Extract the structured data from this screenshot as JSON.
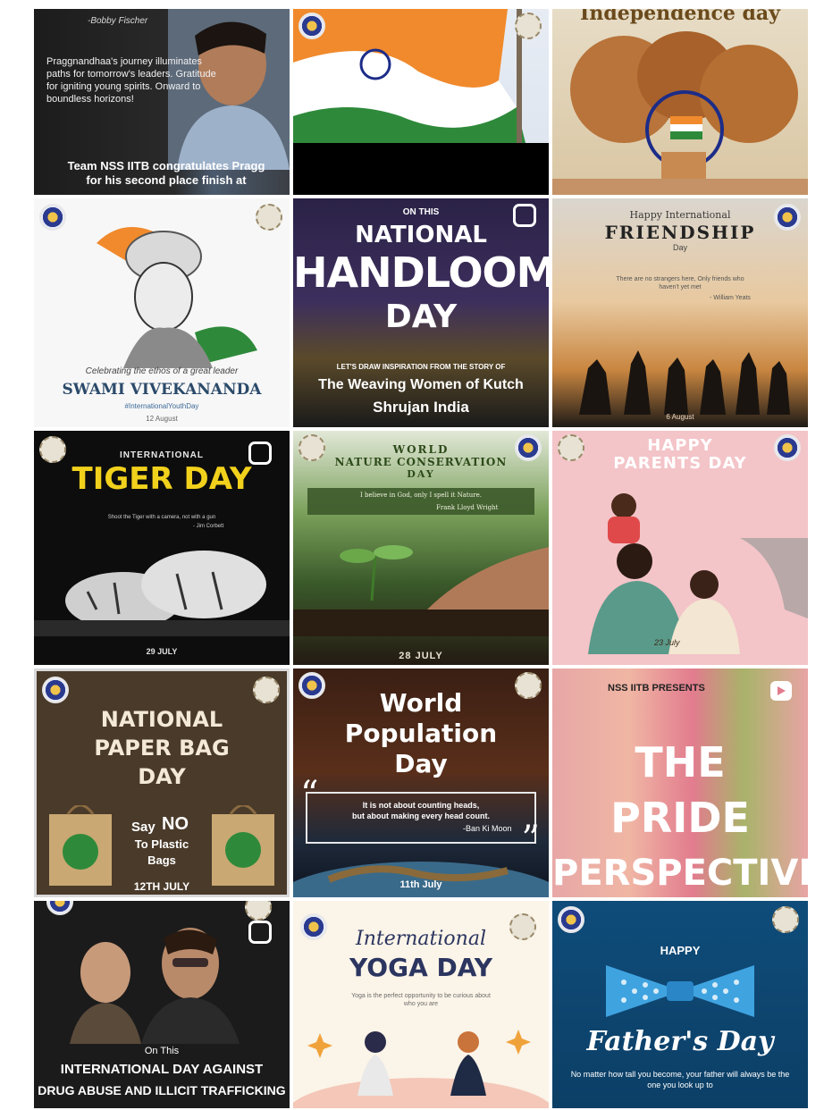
{
  "tiles": {
    "pragg": {
      "attribution": "-Bobby Fischer",
      "quote": "Praggnandhaa's journey illuminates paths for tomorrow's leaders. Gratitude for igniting young spirits. Onward to boundless horizons!",
      "caption": "Team NSS IITB congratulates Pragg for his second place finish at"
    },
    "indep": {
      "heading": "Independence day"
    },
    "vivek": {
      "tagline": "Celebrating the ethos of a great leader",
      "title": "SWAMI VIVEKANANDA",
      "hashtag": "#InternationalYouthDay",
      "date": "12 August"
    },
    "handloom": {
      "kicker": "ON THIS",
      "line1": "NATIONAL",
      "line2": "HANDLOOM",
      "line3": "DAY",
      "sub": "LET'S DRAW INSPIRATION FROM THE STORY OF",
      "story1": "The Weaving Women of Kutch",
      "story2": "Shrujan India"
    },
    "friendship": {
      "pre": "Happy International",
      "title": "FRIENDSHIP",
      "day": "Day",
      "quote": "There are no strangers here, Only friends who haven't yet met",
      "author": "- William Yeats",
      "date": "6 August"
    },
    "tiger": {
      "pre": "INTERNATIONAL",
      "title": "TIGER DAY",
      "quote": "Shoot the Tiger with a camera, not with a gun",
      "author": "- Jim Corbett",
      "date": "29 JULY"
    },
    "nature": {
      "line1": "WORLD",
      "line2": "NATURE CONSERVATION",
      "line3": "DAY",
      "quote": "I believe in God, only I spell it Nature.",
      "author": "Frank Lloyd Wright",
      "date": "28 JULY"
    },
    "parents": {
      "line1": "HAPPY",
      "line2": "PARENTS DAY",
      "date": "23 July"
    },
    "paperbag": {
      "line1": "NATIONAL",
      "line2": "PAPER BAG",
      "line3": "DAY",
      "say": "Say",
      "no": "NO",
      "to": "To Plastic",
      "bags": "Bags",
      "date": "12TH JULY"
    },
    "population": {
      "line1": "World",
      "line2": "Population",
      "line3": "Day",
      "quote1": "It is not about counting heads,",
      "quote2": "but about making every head count.",
      "author": "-Ban Ki Moon",
      "date": "11th July"
    },
    "pride": {
      "presents": "NSS IITB PRESENTS",
      "line1": "THE",
      "line2": "PRIDE",
      "line3": "PERSPECTIVE"
    },
    "drug": {
      "kicker": "On This",
      "line1": "INTERNATIONAL DAY AGAINST",
      "line2": "DRUG ABUSE AND ILLICIT TRAFFICKING"
    },
    "yoga": {
      "script": "International",
      "title": "YOGA DAY",
      "sub": "Yoga is the perfect opportunity to be curious about who you are"
    },
    "father": {
      "happy": "HAPPY",
      "title": "Father's Day",
      "quote": "No matter how tall you become, your father will always be the one you look up to"
    }
  }
}
